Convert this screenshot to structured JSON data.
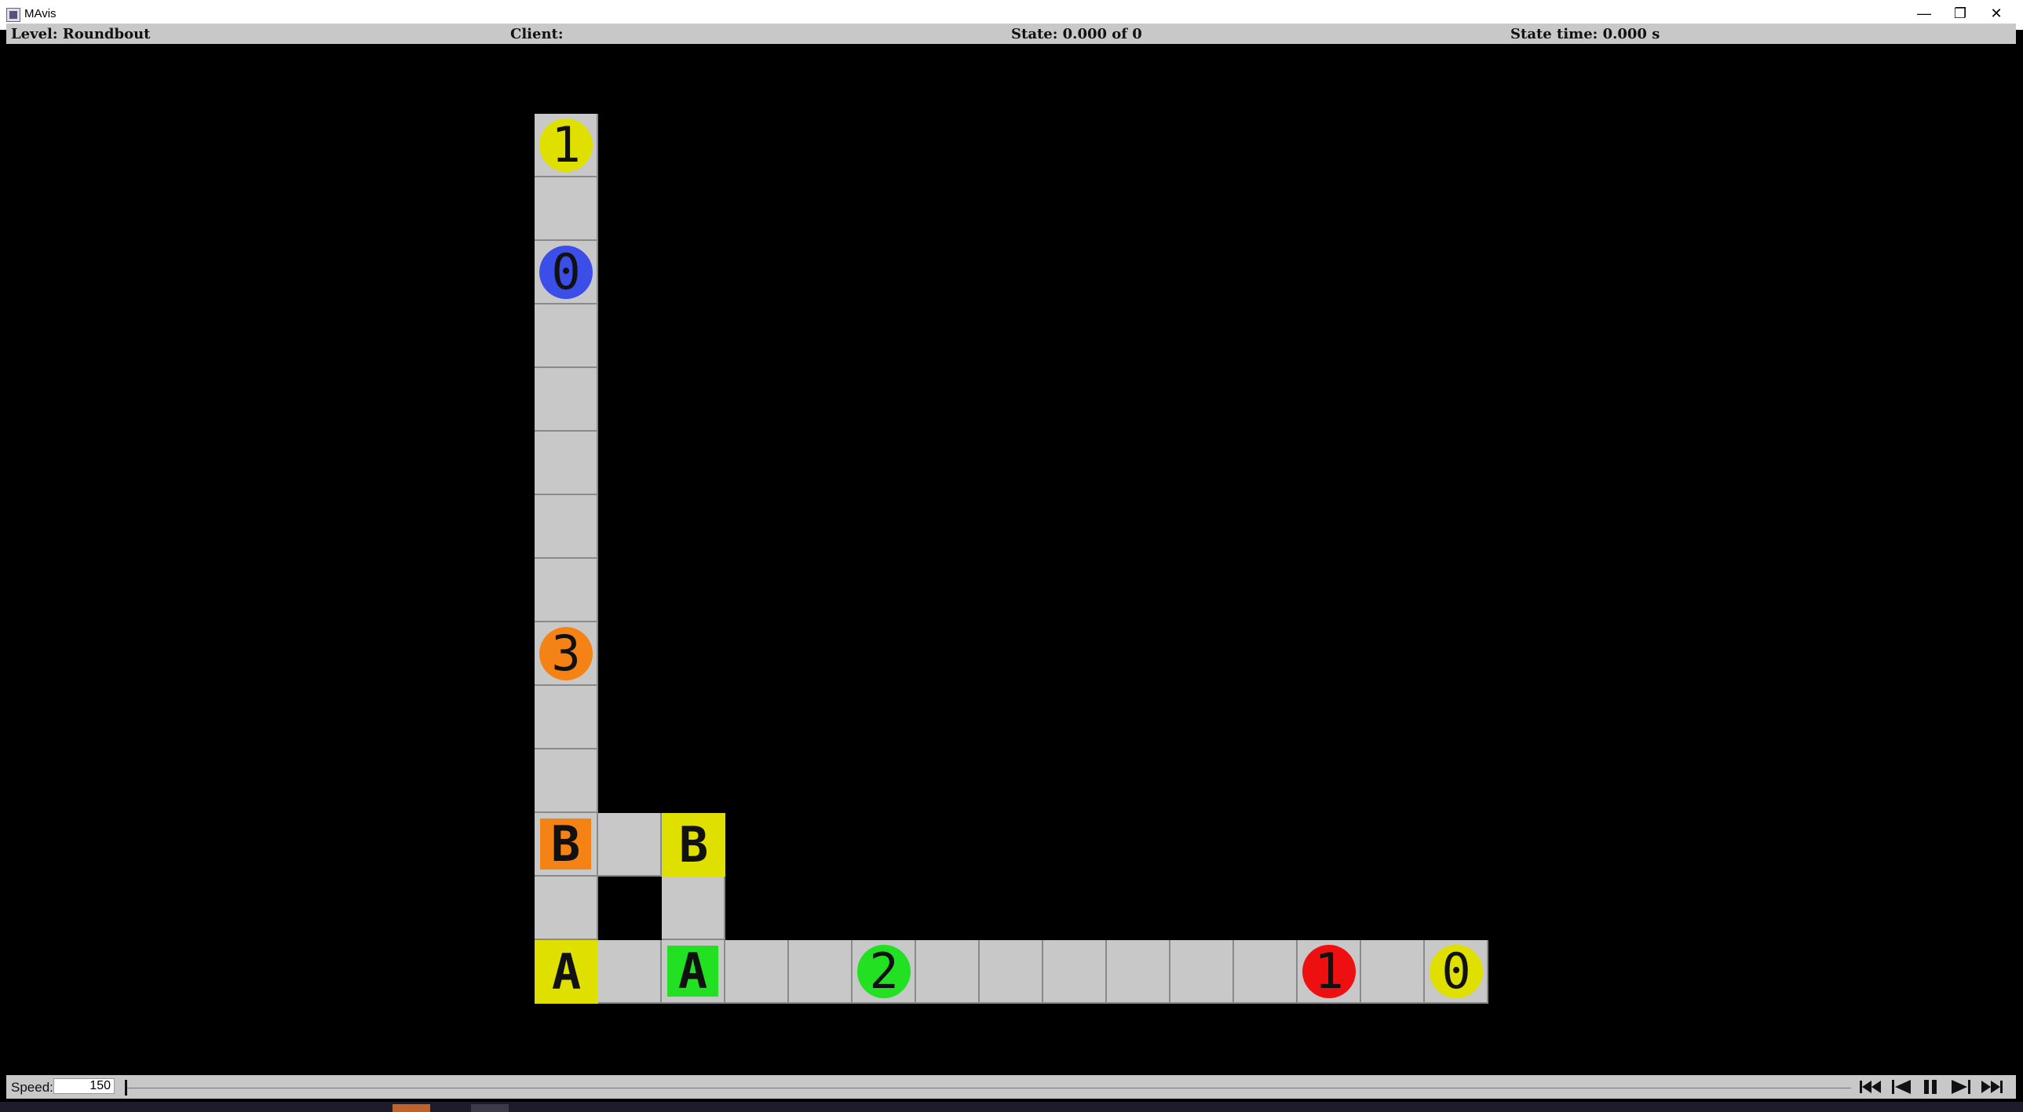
{
  "window": {
    "title": "MAvis",
    "minimize_glyph": "—",
    "maximize_glyph": "❐",
    "close_glyph": "✕"
  },
  "infobar": {
    "level": "Level: Roundbout",
    "client": "Client:",
    "state": "State: 0.000 of 0",
    "state_time": "State time: 0.000 s"
  },
  "controls": {
    "speed_label": "Speed:",
    "speed_value": "150",
    "buttons": [
      "skip-to-start",
      "step-back",
      "pause",
      "step-forward",
      "skip-to-end"
    ]
  },
  "colors": {
    "floor": "#c8c8c8",
    "wall": "#000000",
    "yellow": "#e0e000",
    "blue": "#3b4ee8",
    "orange": "#f58214",
    "green": "#22e022",
    "red": "#ee1010"
  },
  "level": {
    "cells": [
      [
        0,
        0
      ],
      [
        0,
        1
      ],
      [
        0,
        2
      ],
      [
        0,
        3
      ],
      [
        0,
        4
      ],
      [
        0,
        5
      ],
      [
        0,
        6
      ],
      [
        0,
        7
      ],
      [
        0,
        8
      ],
      [
        0,
        9
      ],
      [
        0,
        10
      ],
      [
        0,
        11
      ],
      [
        0,
        12
      ],
      [
        0,
        13
      ],
      [
        1,
        11
      ],
      [
        2,
        11
      ],
      [
        2,
        12
      ],
      [
        1,
        13
      ],
      [
        2,
        13
      ],
      [
        3,
        13
      ],
      [
        4,
        13
      ],
      [
        5,
        13
      ],
      [
        6,
        13
      ],
      [
        7,
        13
      ],
      [
        8,
        13
      ],
      [
        9,
        13
      ],
      [
        10,
        13
      ],
      [
        11,
        13
      ],
      [
        12,
        13
      ],
      [
        13,
        13
      ],
      [
        14,
        13
      ]
    ],
    "agents": [
      {
        "label": "1",
        "color": "yellow",
        "col": 0,
        "row": 0
      },
      {
        "label": "0",
        "color": "blue",
        "col": 0,
        "row": 2
      },
      {
        "label": "3",
        "color": "orange",
        "col": 0,
        "row": 8
      },
      {
        "label": "2",
        "color": "green",
        "col": 5,
        "row": 13
      },
      {
        "label": "1",
        "color": "red",
        "col": 12,
        "row": 13
      },
      {
        "label": "0",
        "color": "yellow",
        "col": 14,
        "row": 13
      }
    ],
    "boxes": [
      {
        "label": "B",
        "color": "orange",
        "col": 0,
        "row": 11
      },
      {
        "label": "A",
        "color": "green",
        "col": 2,
        "row": 13
      }
    ],
    "goals": [
      {
        "label": "B",
        "color": "yellow",
        "col": 2,
        "row": 11
      },
      {
        "label": "A",
        "color": "yellow",
        "col": 0,
        "row": 13
      }
    ]
  }
}
